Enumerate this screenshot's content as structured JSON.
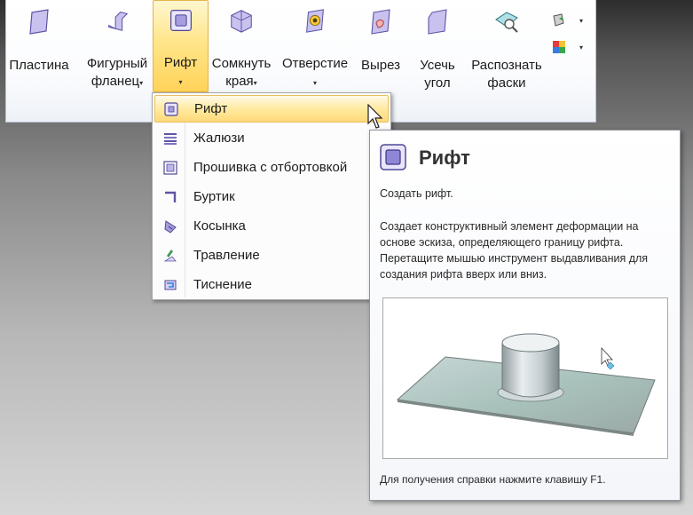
{
  "ribbon": {
    "buttons": [
      {
        "label": "Пластина",
        "icon": "plate-icon"
      },
      {
        "label": "Фигурный фланец",
        "icon": "contour-flange-icon"
      },
      {
        "label": "Рифт",
        "icon": "dimple-icon",
        "active": true
      },
      {
        "label": "Сомкнуть края",
        "icon": "close-corner-icon"
      },
      {
        "label": "Отверстие",
        "icon": "hole-icon"
      },
      {
        "label": "Вырез",
        "icon": "cutout-icon"
      },
      {
        "label": "Усечь угол",
        "icon": "chamfer-corner-icon"
      },
      {
        "label": "Распознать фаски",
        "icon": "recognize-chamfers-icon"
      }
    ],
    "line1": [
      "Пластина",
      "Фигурный",
      "Рифт",
      "Сомкнуть",
      "Отверстие",
      "Вырез",
      "Усечь",
      "Распознать"
    ],
    "line2": [
      "",
      "фланец",
      "",
      "края",
      "",
      "",
      "угол",
      "фаски"
    ]
  },
  "menu": {
    "items": [
      {
        "label": "Рифт",
        "icon": "dimple-icon"
      },
      {
        "label": "Жалюзи",
        "icon": "louver-icon"
      },
      {
        "label": "Прошивка с отбортовкой",
        "icon": "drawn-cutout-icon"
      },
      {
        "label": "Буртик",
        "icon": "bead-icon"
      },
      {
        "label": "Косынка",
        "icon": "gusset-icon"
      },
      {
        "label": "Травление",
        "icon": "etch-icon"
      },
      {
        "label": "Тиснение",
        "icon": "emboss-icon"
      }
    ]
  },
  "tooltip": {
    "title": "Рифт",
    "subtitle": "Создать рифт.",
    "description": "Создает конструктивный элемент деформации на основе эскиза, определяющего границу рифта. Перетащите мышью инструмент выдавливания для создания рифта вверх или вниз.",
    "footer": "Для получения справки нажмите клавишу F1."
  },
  "colors": {
    "highlight": "#ffd978",
    "active_button": "#ffe58a",
    "icon_purple": "#7b6fc8"
  }
}
